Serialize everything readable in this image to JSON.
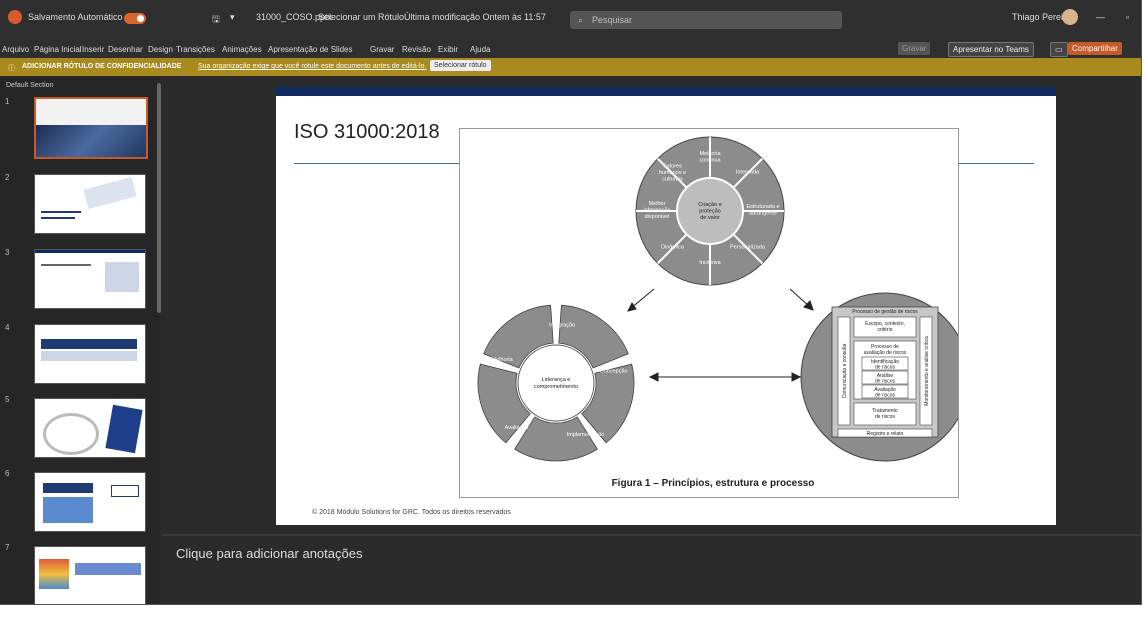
{
  "titlebar": {
    "autosave": "Salvamento Automático",
    "filename": "31000_COSO.pptx",
    "label_hint": "Selecionar um Rótulo",
    "last_modified": "Última modificação Ontem às 11:57",
    "search_placeholder": "Pesquisar",
    "user": "Thiago Pereira"
  },
  "menu": [
    "Arquivo",
    "Página Inicial",
    "Inserir",
    "Desenhar",
    "Design",
    "Transições",
    "Animações",
    "Apresentação de Slides",
    "Gravar",
    "Revisão",
    "Exibir",
    "Ajuda"
  ],
  "toolbar": {
    "record": "Gravar",
    "present_teams": "Apresentar no Teams",
    "share": "Compartilhar"
  },
  "infobar": {
    "title": "ADICIONAR RÓTULO DE CONFIDENCIALIDADE",
    "message": "Sua organização exige que você rotule este documento antes de editá-lo.",
    "button": "Selecionar rótulo"
  },
  "sidebar": {
    "section": "Default Section",
    "slides": [
      "1",
      "2",
      "3",
      "4",
      "5",
      "6",
      "7"
    ]
  },
  "slide": {
    "title": "ISO 31000:2018",
    "footer": "© 2018 Módulo Solutions for GRC. Todos os direitos reservados",
    "figure": {
      "caption": "Figura 1 – Princípios, estrutura e processo",
      "principles_center": [
        "Criação e",
        "proteção",
        "de valor"
      ],
      "principles": [
        [
          "Melhoria",
          "contínua"
        ],
        [
          "Integrada"
        ],
        [
          "Estruturada e",
          "abrangente"
        ],
        [
          "Personalizada"
        ],
        [
          "Inclusiva"
        ],
        [
          "Dinâmica"
        ],
        [
          "Melhor",
          "informação",
          "disponível"
        ],
        [
          "Fatores",
          "humanos e",
          "culturais"
        ]
      ],
      "framework_center": [
        "Liderança e",
        "comprometimento"
      ],
      "framework": [
        "Integração",
        "Concepção",
        "Implementação",
        "Avaliação",
        "Melhoria"
      ],
      "process": {
        "title": "Processo de gestão de riscos",
        "scope": [
          "Escopo, contexto,",
          "critério"
        ],
        "assessment": [
          "Processo de",
          "avaliação de riscos"
        ],
        "steps": [
          [
            "Identificação",
            "de riscos"
          ],
          [
            "Análise",
            "de riscos"
          ],
          [
            "Avaliação",
            "de riscos"
          ]
        ],
        "treatment": [
          "Tratamento",
          "de riscos"
        ],
        "left_bar": "Comunicação e consulta",
        "right_bar": "Monitoramento e análise crítica",
        "bottom": "Registro e relato"
      }
    }
  },
  "notes": {
    "placeholder": "Clique para adicionar anotações"
  }
}
